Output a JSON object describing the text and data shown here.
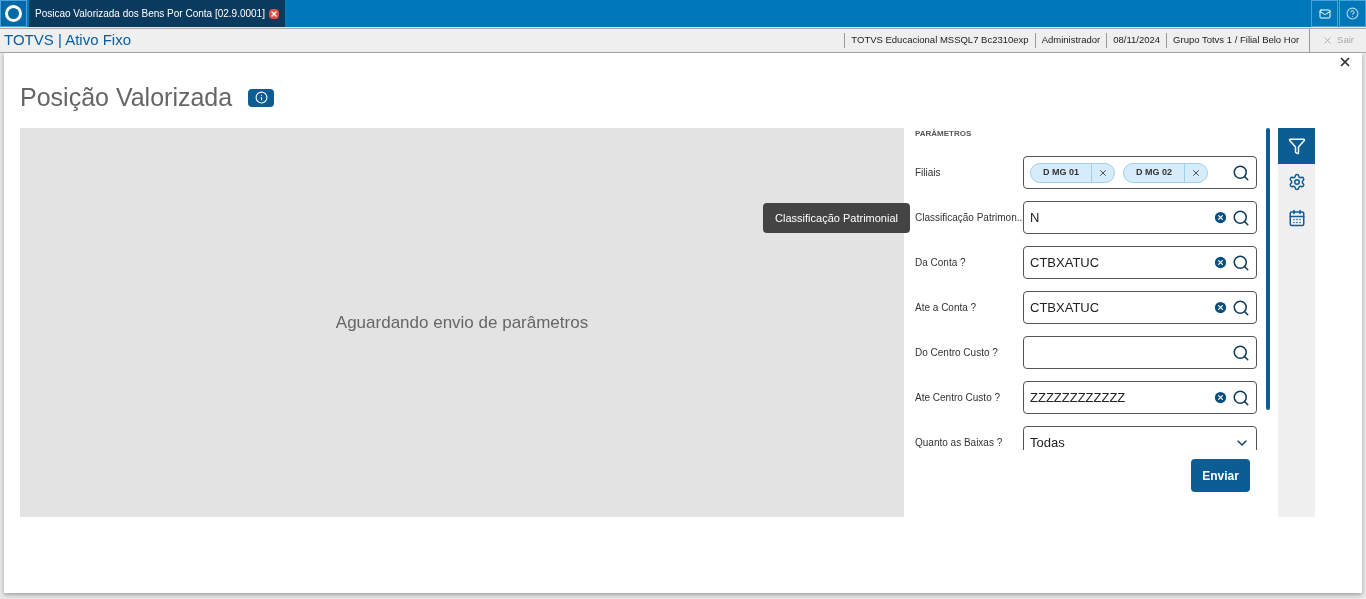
{
  "topbar": {
    "tab": {
      "label": "Posicao Valorizada dos Bens Por Conta [02.9.0001]",
      "selected": true
    }
  },
  "infobar": {
    "app_title": "TOTVS | Ativo Fixo",
    "items": [
      "TOTVS Educacional MSSQL7 Bc2310exp",
      "Administrador",
      "08/11/2024",
      "Grupo Totvs 1 / Filial Belo Hor"
    ],
    "logout": {
      "label": "Sair",
      "disabled": true
    }
  },
  "page": {
    "title": "Posição Valorizada",
    "preview_message": "Aguardando envio de parâmetros"
  },
  "params": {
    "heading": "PARÂMETROS",
    "fields": [
      {
        "kind": "chips",
        "label": "Filiais",
        "chips": [
          "D MG 01",
          "D MG 02"
        ],
        "clearable": false
      },
      {
        "kind": "lookup",
        "label": "Classificação Patrimon...",
        "value": "N",
        "clearable": true
      },
      {
        "kind": "lookup",
        "label": "Da Conta ?",
        "value": "CTBXATUC",
        "clearable": true
      },
      {
        "kind": "lookup",
        "label": "Ate a Conta ?",
        "value": "CTBXATUC",
        "clearable": true
      },
      {
        "kind": "lookup",
        "label": "Do Centro Custo ?",
        "clearable": false
      },
      {
        "kind": "lookup",
        "label": "Ate Centro Custo ?",
        "value": "ZZZZZZZZZZZZ",
        "clearable": true
      },
      {
        "kind": "select",
        "label": "Quanto as Baixas ?",
        "value": "Todas",
        "clearable": false
      }
    ],
    "submit": "Enviar"
  },
  "tooltip": "Classificação Patrimonial",
  "side_tools": [
    {
      "kind": "filter",
      "selected": true
    },
    {
      "kind": "settings",
      "selected": false
    },
    {
      "kind": "calendar",
      "selected": false
    }
  ]
}
